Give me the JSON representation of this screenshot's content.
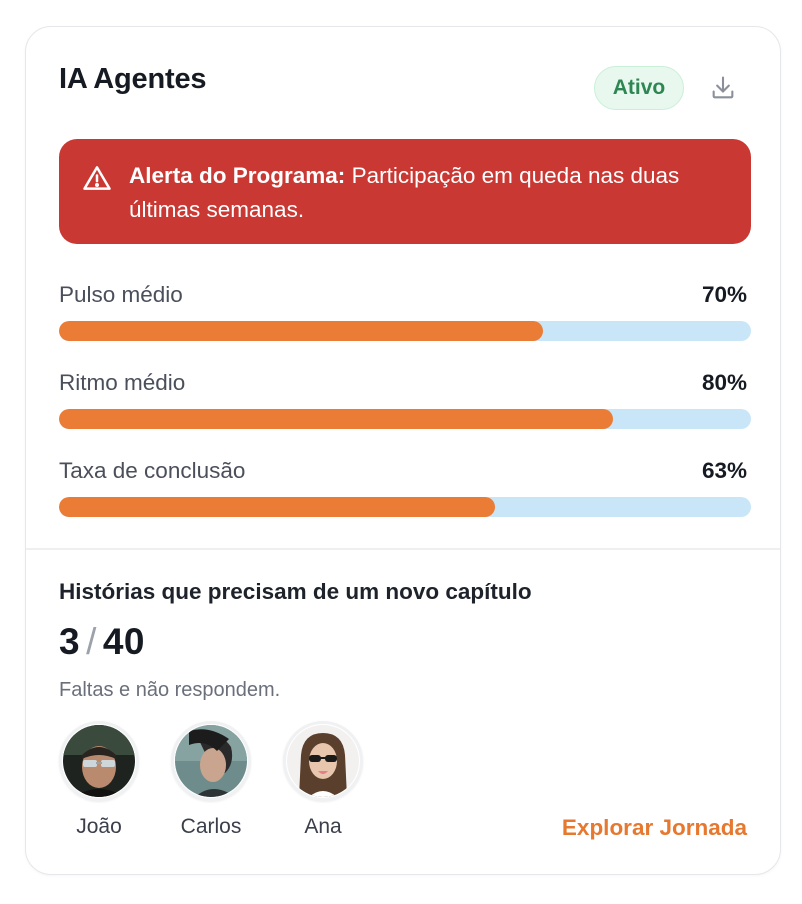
{
  "card": {
    "title": "IA Agentes",
    "status": "Ativo",
    "download_icon": "download-icon"
  },
  "alert": {
    "icon": "warning-triangle-icon",
    "title": "Alerta do Programa:",
    "message": " Participação em queda nas duas últimas semanas."
  },
  "metrics": [
    {
      "label": "Pulso médio",
      "value_text": "70%",
      "value": 0.7
    },
    {
      "label": "Ritmo médio",
      "value_text": "80%",
      "value": 0.8
    },
    {
      "label": "Taxa de conclusão",
      "value_text": "63%",
      "value": 0.63
    }
  ],
  "stories": {
    "title": "Histórias que precisam de um novo capítulo",
    "count": "3",
    "separator": "/",
    "total": "40",
    "subtitle": "Faltas e não respondem.",
    "people": [
      {
        "name": "João"
      },
      {
        "name": "Carlos"
      },
      {
        "name": "Ana"
      }
    ],
    "link": "Explorar Jornada"
  },
  "colors": {
    "accent": "#eb7c35",
    "track": "#c8e6f8",
    "alert": "#c93833",
    "badge_bg": "#e9f8ef",
    "badge_text": "#2e8753"
  }
}
